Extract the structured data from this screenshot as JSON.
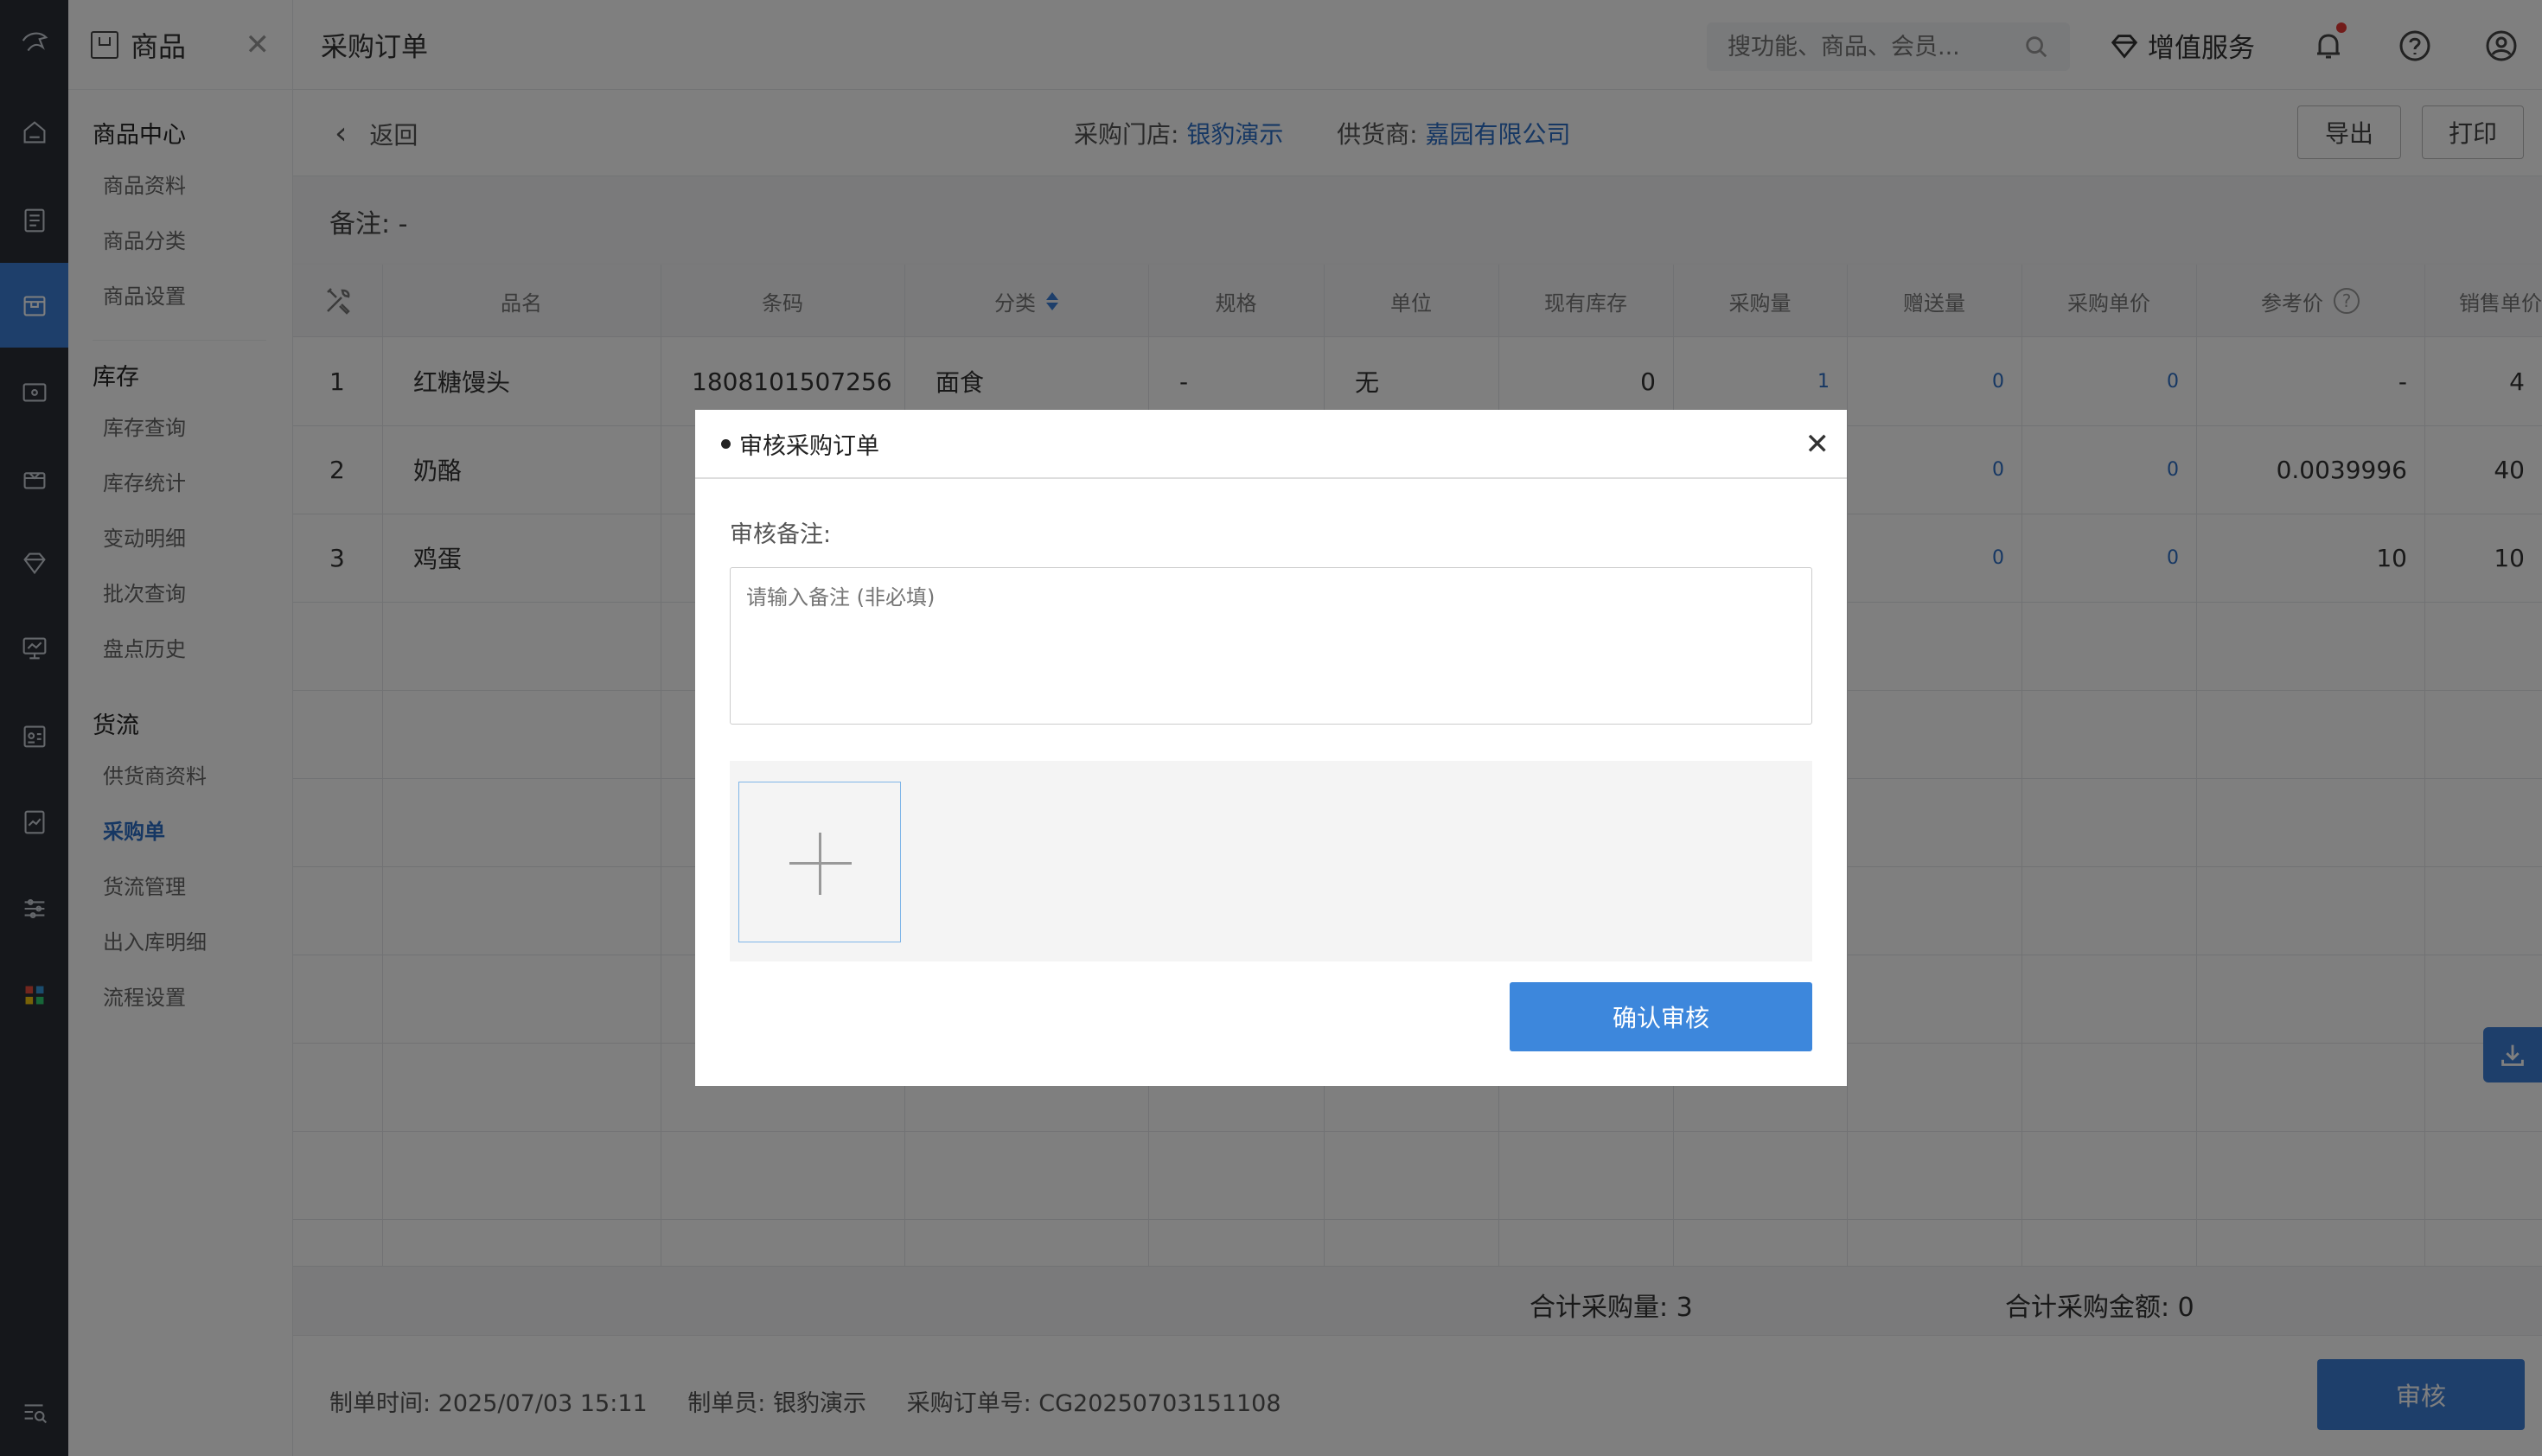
{
  "app": {
    "module_title": "商品",
    "page_title": "采购订单"
  },
  "sidebar": {
    "groups": [
      {
        "title": "商品中心",
        "items": [
          "商品资料",
          "商品分类",
          "商品设置"
        ]
      },
      {
        "title": "库存",
        "items": [
          "库存查询",
          "库存统计",
          "变动明细",
          "批次查询",
          "盘点历史"
        ]
      },
      {
        "title": "货流",
        "items": [
          "供货商资料",
          "采购单",
          "货流管理",
          "出入库明细",
          "流程设置"
        ]
      }
    ],
    "active_item": "采购单"
  },
  "topbar": {
    "search_placeholder": "搜功能、商品、会员...",
    "value_added_service": "增值服务"
  },
  "subheader": {
    "back_label": "返回",
    "store_label": "采购门店:",
    "store_value": "银豹演示",
    "supplier_label": "供货商:",
    "supplier_value": "嘉园有限公司",
    "export_label": "导出",
    "print_label": "打印"
  },
  "remark": "备注: -",
  "table": {
    "columns": [
      "品名",
      "条码",
      "分类",
      "规格",
      "单位",
      "现有库存",
      "采购量",
      "赠送量",
      "采购单价",
      "参考价",
      "销售单价"
    ],
    "rows": [
      {
        "index": "1",
        "name": "红糖馒头",
        "barcode": "1808101507256",
        "category": "面食",
        "spec": "-",
        "unit": "无",
        "stock": "0",
        "qty": "1",
        "gift": "0",
        "price": "0",
        "ref_price": "-",
        "sale_price": "4"
      },
      {
        "index": "2",
        "name": "奶酪",
        "barcode": "",
        "category": "",
        "spec": "",
        "unit": "",
        "stock": "",
        "qty": "",
        "gift": "0",
        "price": "0",
        "ref_price": "0.0039996",
        "sale_price": "40"
      },
      {
        "index": "3",
        "name": "鸡蛋",
        "barcode": "",
        "category": "",
        "spec": "",
        "unit": "",
        "stock": "",
        "qty": "",
        "gift": "0",
        "price": "0",
        "ref_price": "10",
        "sale_price": "10"
      }
    ]
  },
  "summary": {
    "total_qty": "合计采购量: 3",
    "total_amount": "合计采购金额: 0"
  },
  "footer": {
    "created_time": "制单时间: 2025/07/03 15:11",
    "creator": "制单员: 银豹演示",
    "order_no": "采购订单号: CG20250703151108",
    "audit_button": "审核"
  },
  "modal": {
    "title": "审核采购订单",
    "remark_label": "审核备注:",
    "remark_placeholder": "请输入备注 (非必填)",
    "confirm_button": "确认审核"
  },
  "colors": {
    "primary": "#3d7fd6",
    "link": "#2d6fc7",
    "rail_bg": "#2b2f36"
  }
}
